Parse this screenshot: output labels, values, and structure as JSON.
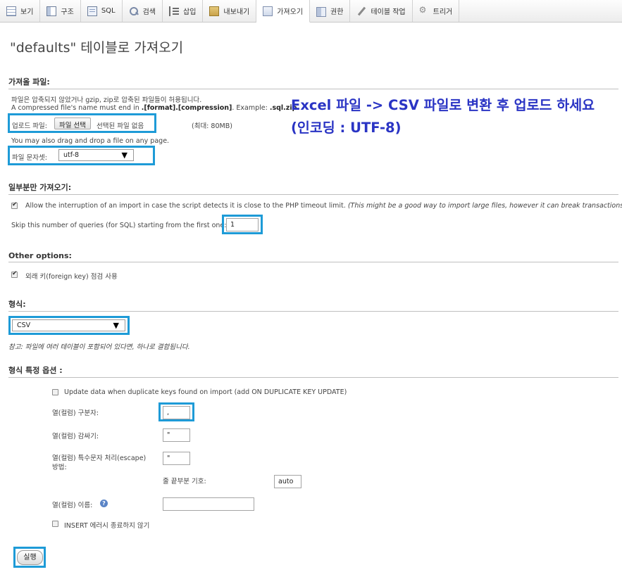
{
  "tabs": [
    {
      "label": "보기",
      "icon": "table-icon"
    },
    {
      "label": "구조",
      "icon": "structure-icon"
    },
    {
      "label": "SQL",
      "icon": "sql-icon"
    },
    {
      "label": "검색",
      "icon": "search-icon"
    },
    {
      "label": "삽입",
      "icon": "insert-icon"
    },
    {
      "label": "내보내기",
      "icon": "export-icon"
    },
    {
      "label": "가져오기",
      "icon": "import-icon",
      "active": true
    },
    {
      "label": "권한",
      "icon": "privileges-icon"
    },
    {
      "label": "테이블 작업",
      "icon": "operations-icon"
    },
    {
      "label": "트리거",
      "icon": "triggers-icon"
    }
  ],
  "page_title": "\"defaults\" 테이블로 가져오기",
  "file_section": {
    "heading": "가져올 파일:",
    "line1": "파일은 압축되지 않았거나 gzip, zip로 압축된 파일들이 허용됩니다.",
    "line2_pre": "A compressed file's name must end in ",
    "line2_bold": ".[format].[compression]",
    "line2_mid": ". Example: ",
    "line2_example": ".sql.zip",
    "upload_label": "업로드 파일:",
    "file_button": "파일 선택",
    "no_file": "선택된 파일 없음",
    "max_size": "(최대: 80MB)",
    "drag_drop": "You may also drag and drop a file on any page.",
    "charset_label": "파일 문자셋:",
    "charset_value": "utf-8"
  },
  "annotation": {
    "line1": "Excel 파일 -> CSV 파일로 변환 후 업로드 하세요",
    "line2": "(인코딩 : UTF-8)"
  },
  "partial_section": {
    "heading": "일부분만 가져오기:",
    "allow_interrupt": "Allow the interruption of an import in case the script detects it is close to the PHP timeout limit.",
    "allow_interrupt_note": "(This might be a good way to import large files, however it can break transactions.)",
    "skip_label": "Skip this number of queries (for SQL) starting from the first one:",
    "skip_value": "1"
  },
  "other_section": {
    "heading": "Other options:",
    "fk_checks": "외래 키(foreign key) 점검 사용"
  },
  "format_section": {
    "heading": "형식:",
    "format_value": "CSV",
    "note": "참고: 파일에 여러 테이블이 포함되어 있다면, 하나로 결합됩니다."
  },
  "format_options": {
    "heading": "형식 특정 옵션 :",
    "update_dup": "Update data when duplicate keys found on import (add ON DUPLICATE KEY UPDATE)",
    "col_sep_label": "열(컬럼) 구분자:",
    "col_sep_value": ",",
    "col_enclosed_label": "열(컬럼) 감싸기:",
    "col_enclosed_value": "\"",
    "col_escape_label_1": "열(컬럼) 특수문자 처리(escape)",
    "col_escape_label_2": "방법:",
    "col_escape_value": "\"",
    "line_term_label": "줄 끝부분 기호:",
    "line_term_value": "auto",
    "col_names_label": "열(컬럼) 이름:",
    "col_names_value": "",
    "no_abort": "INSERT 에러시 종료하지 않기"
  },
  "submit_label": "실행",
  "colors": {
    "highlight": "#1e9bd7",
    "annotation": "#2a34c4"
  }
}
